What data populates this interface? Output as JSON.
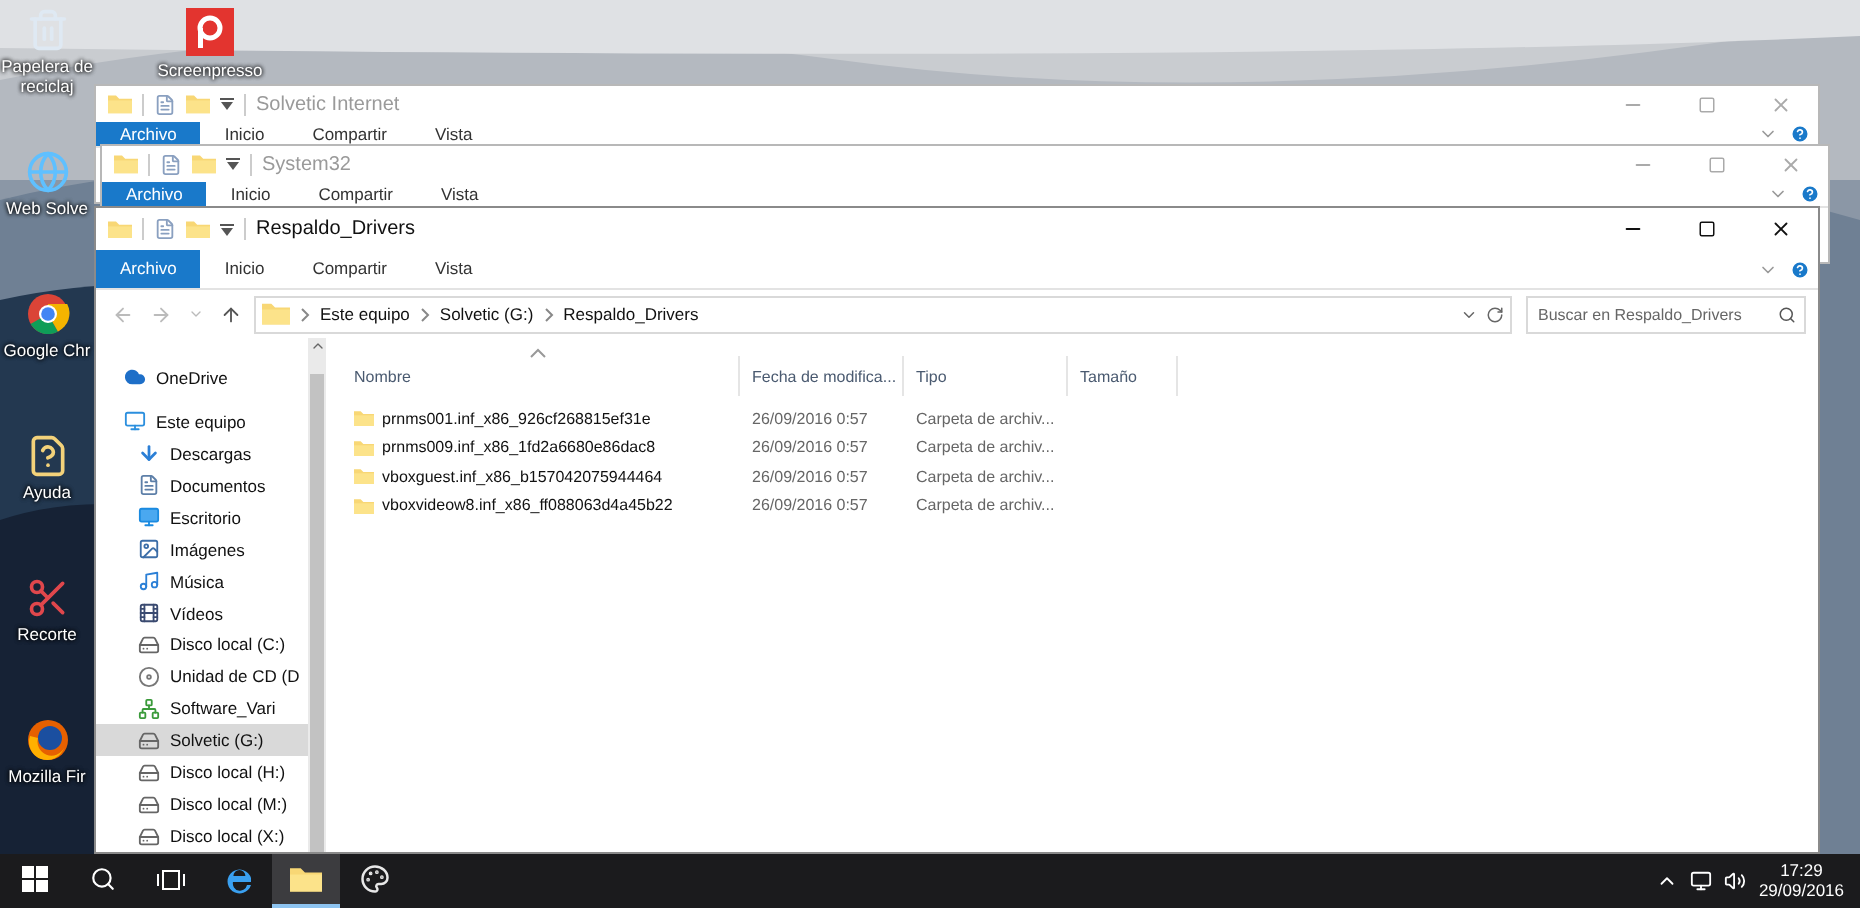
{
  "desktop": {
    "columns": [
      [
        {
          "label": "Papelera de reciclaj",
          "kind": "recycle"
        },
        {
          "label": "Web Solve",
          "kind": "globe"
        },
        {
          "label": "Google Chr",
          "kind": "chrome"
        },
        {
          "label": "Ayuda",
          "kind": "help"
        },
        {
          "label": "Recorte",
          "kind": "snip"
        },
        {
          "label": "Mozilla Fir",
          "kind": "firefox"
        }
      ],
      [
        {
          "label": "Screenpresso",
          "kind": "screenpresso"
        }
      ]
    ]
  },
  "windows": [
    {
      "title": "Solvetic Internet",
      "active": false,
      "tabs": [
        {
          "label": "Archivo",
          "selected": true
        },
        {
          "label": "Inicio",
          "selected": false
        },
        {
          "label": "Compartir",
          "selected": false
        },
        {
          "label": "Vista",
          "selected": false
        }
      ]
    },
    {
      "title": "System32",
      "active": false,
      "tabs": [
        {
          "label": "Archivo",
          "selected": true
        },
        {
          "label": "Inicio",
          "selected": false
        },
        {
          "label": "Compartir",
          "selected": false
        },
        {
          "label": "Vista",
          "selected": false
        }
      ]
    },
    {
      "title": "Respaldo_Drivers",
      "active": true,
      "tabs": [
        {
          "label": "Archivo",
          "selected": true
        },
        {
          "label": "Inicio",
          "selected": false
        },
        {
          "label": "Compartir",
          "selected": false
        },
        {
          "label": "Vista",
          "selected": false
        }
      ],
      "address": {
        "path": [
          "Este equipo",
          "Solvetic (G:)",
          "Respaldo_Drivers"
        ]
      },
      "search": {
        "placeholder": "Buscar en Respaldo_Drivers"
      },
      "navigation": [
        {
          "label": "OneDrive",
          "kind": "cloud",
          "selected": false
        },
        {
          "label": "Este equipo",
          "kind": "pc",
          "selected": false,
          "children": [
            {
              "label": "Descargas",
              "kind": "download",
              "selected": false
            },
            {
              "label": "Documentos",
              "kind": "document",
              "selected": false
            },
            {
              "label": "Escritorio",
              "kind": "desktop",
              "selected": false
            },
            {
              "label": "Imágenes",
              "kind": "pictures",
              "selected": false
            },
            {
              "label": "Música",
              "kind": "music",
              "selected": false
            },
            {
              "label": "Vídeos",
              "kind": "video",
              "selected": false
            },
            {
              "label": "Disco local (C:)",
              "kind": "disk",
              "selected": false
            },
            {
              "label": "Unidad de CD (D",
              "kind": "cd",
              "selected": false
            },
            {
              "label": "Software_Vari",
              "kind": "network",
              "selected": false
            },
            {
              "label": "Solvetic (G:)",
              "kind": "disk",
              "selected": true
            },
            {
              "label": "Disco local (H:)",
              "kind": "disk",
              "selected": false
            },
            {
              "label": "Disco local (M:)",
              "kind": "disk",
              "selected": false
            },
            {
              "label": "Disco local (X:)",
              "kind": "disk",
              "selected": false
            }
          ]
        }
      ],
      "table": {
        "columns": [
          "Nombre",
          "Fecha de modifica...",
          "Tipo",
          "Tamaño"
        ],
        "rows": [
          {
            "name": "prnms001.inf_x86_926cf268815ef31e",
            "date": "26/09/2016 0:57",
            "type": "Carpeta de archiv..."
          },
          {
            "name": "prnms009.inf_x86_1fd2a6680e86dac8",
            "date": "26/09/2016 0:57",
            "type": "Carpeta de archiv..."
          },
          {
            "name": "vboxguest.inf_x86_b157042075944464",
            "date": "26/09/2016 0:57",
            "type": "Carpeta de archiv..."
          },
          {
            "name": "vboxvideow8.inf_x86_ff088063d4a45b22",
            "date": "26/09/2016 0:57",
            "type": "Carpeta de archiv..."
          }
        ]
      }
    }
  ],
  "taskbar": {
    "items": [
      {
        "kind": "start",
        "selected": false
      },
      {
        "kind": "search",
        "selected": false
      },
      {
        "kind": "taskview",
        "selected": false
      },
      {
        "kind": "edge",
        "selected": false
      },
      {
        "kind": "explorer",
        "selected": true
      },
      {
        "kind": "paint",
        "selected": false
      }
    ],
    "time": "17:29",
    "date": "29/09/2016"
  }
}
